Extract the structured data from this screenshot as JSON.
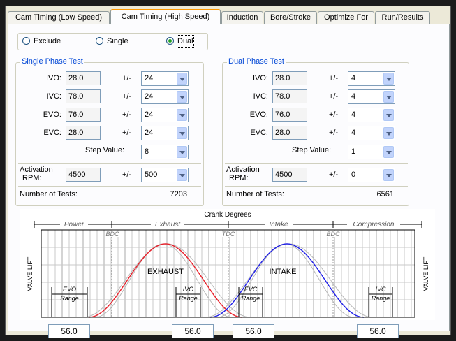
{
  "tabs": [
    {
      "label": "Cam Timing (Low Speed)",
      "active": false
    },
    {
      "label": "Cam Timing (High Speed)",
      "active": true
    },
    {
      "label": "Induction",
      "active": false
    },
    {
      "label": "Bore/Stroke",
      "active": false
    },
    {
      "label": "Optimize For",
      "active": false
    },
    {
      "label": "Run/Results",
      "active": false
    }
  ],
  "mode": {
    "options": [
      "Exclude",
      "Single",
      "Dual"
    ],
    "selected": "Dual"
  },
  "single": {
    "title": "Single Phase Test",
    "rows": [
      {
        "label": "IVO:",
        "value": "28.0",
        "pm": "+/-",
        "range": "24"
      },
      {
        "label": "IVC:",
        "value": "78.0",
        "pm": "+/-",
        "range": "24"
      },
      {
        "label": "EVO:",
        "value": "76.0",
        "pm": "+/-",
        "range": "24"
      },
      {
        "label": "EVC:",
        "value": "28.0",
        "pm": "+/-",
        "range": "24"
      }
    ],
    "step_label": "Step Value:",
    "step_value": "8",
    "activation_label_1": "Activation",
    "activation_label_2": "RPM:",
    "activation_value": "4500",
    "activation_pm": "+/-",
    "activation_range": "500",
    "tests_label": "Number of Tests:",
    "tests_value": "7203"
  },
  "dual": {
    "title": "Dual Phase Test",
    "rows": [
      {
        "label": "IVO:",
        "value": "28.0",
        "pm": "+/-",
        "range": "4"
      },
      {
        "label": "IVC:",
        "value": "78.0",
        "pm": "+/-",
        "range": "4"
      },
      {
        "label": "EVO:",
        "value": "76.0",
        "pm": "+/-",
        "range": "4"
      },
      {
        "label": "EVC:",
        "value": "28.0",
        "pm": "+/-",
        "range": "4"
      }
    ],
    "step_label": "Step Value:",
    "step_value": "1",
    "activation_label_1": "Activation",
    "activation_label_2": "RPM:",
    "activation_value": "4500",
    "activation_pm": "+/-",
    "activation_range": "0",
    "tests_label": "Number of Tests:",
    "tests_value": "6561"
  },
  "graph": {
    "title": "Crank Degrees",
    "strokes": [
      "Power",
      "Exhaust",
      "Intake",
      "Compression"
    ],
    "markers": [
      "BDC",
      "TDC",
      "BDC"
    ],
    "exhaust_label": "EXHAUST",
    "intake_label": "INTAKE",
    "y_label": "VALVE LIFT",
    "evo_range": "EVO Range",
    "ivo_range": "IVO Range",
    "evc_range": "EVC Range",
    "ivc_range": "IVC Range",
    "exhaust_color": "#e8202a",
    "intake_color": "#2020e8"
  },
  "range_values": [
    "56.0",
    "56.0",
    "56.0",
    "56.0"
  ]
}
